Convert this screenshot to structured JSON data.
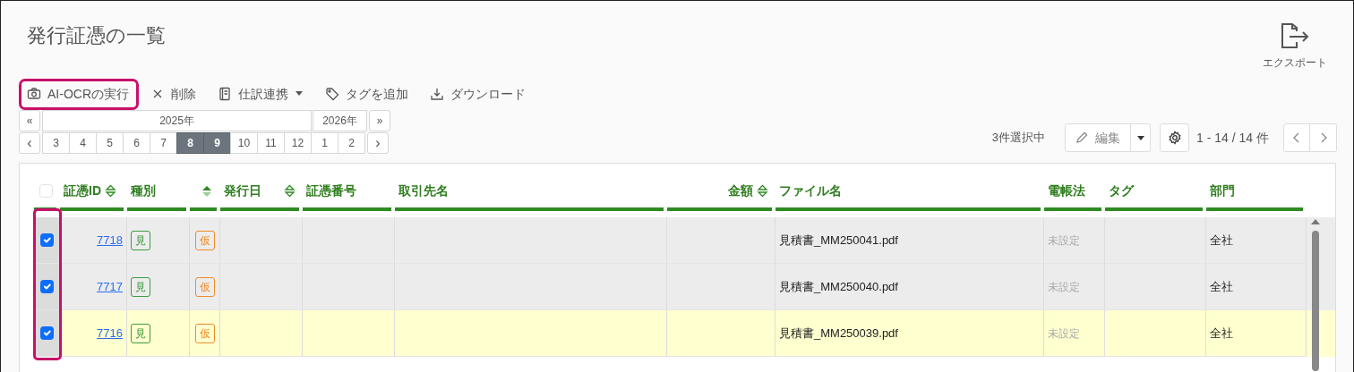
{
  "page": {
    "title": "発行証憑の一覧"
  },
  "export": {
    "label": "エクスポート"
  },
  "toolbar": [
    {
      "kind": "camera",
      "label": "AI-OCRの実行",
      "emphasized": true,
      "dropdown": false
    },
    {
      "kind": "close",
      "label": "削除",
      "emphasized": false,
      "dropdown": false
    },
    {
      "kind": "book",
      "label": "仕訳連携",
      "emphasized": false,
      "dropdown": true
    },
    {
      "kind": "tag",
      "label": "タグを追加",
      "emphasized": false,
      "dropdown": false
    },
    {
      "kind": "download",
      "label": "ダウンロード",
      "emphasized": false,
      "dropdown": false
    }
  ],
  "month_picker": {
    "prev_year": "«",
    "next_year": "»",
    "prev": "‹",
    "next": "›",
    "years": [
      {
        "label": "2025年",
        "months": [
          {
            "label": "3",
            "selected": false
          },
          {
            "label": "4",
            "selected": false
          },
          {
            "label": "5",
            "selected": false
          },
          {
            "label": "6",
            "selected": false
          },
          {
            "label": "7",
            "selected": false
          },
          {
            "label": "8",
            "selected": true
          },
          {
            "label": "9",
            "selected": true
          },
          {
            "label": "10",
            "selected": false
          },
          {
            "label": "11",
            "selected": false
          },
          {
            "label": "12",
            "selected": false
          }
        ]
      },
      {
        "label": "2026年",
        "months": [
          {
            "label": "1",
            "selected": false
          },
          {
            "label": "2",
            "selected": false
          }
        ]
      }
    ]
  },
  "selection_count": "3件選択中",
  "edit_button": {
    "label": "編集"
  },
  "range": "1 - 14 / 14 件",
  "table": {
    "all_checked": false,
    "checkbox_column_emphasized": true,
    "columns": [
      {
        "label": "証憑ID",
        "sortable": true,
        "sort_ascending": false
      },
      {
        "label": "種別"
      },
      {
        "sortable": true,
        "sort_ascending": true
      },
      {
        "label": "発行日",
        "sortable": true,
        "sort_ascending": false
      },
      {
        "label": "証憑番号"
      },
      {
        "label": "取引先名"
      },
      {
        "label": "金額",
        "sortable": true,
        "sort_ascending": false
      },
      {
        "label": "ファイル名"
      },
      {
        "label": "電帳法"
      },
      {
        "label": "タグ"
      },
      {
        "label": "部門"
      }
    ],
    "rows": [
      {
        "selected": true,
        "highlighted": false,
        "id": "7718",
        "type_badge": {
          "text": "見",
          "color": "#3f9b3f"
        },
        "status_badge": {
          "text": "仮",
          "color": "#f08c2a"
        },
        "file": "見積書_MM250041.pdf",
        "denchoho": {
          "text": "未設定",
          "set": false
        },
        "department": "全社"
      },
      {
        "selected": true,
        "highlighted": false,
        "id": "7717",
        "type_badge": {
          "text": "見",
          "color": "#3f9b3f"
        },
        "status_badge": {
          "text": "仮",
          "color": "#f08c2a"
        },
        "file": "見積書_MM250040.pdf",
        "denchoho": {
          "text": "未設定",
          "set": false
        },
        "department": "全社"
      },
      {
        "selected": true,
        "highlighted": true,
        "id": "7716",
        "type_badge": {
          "text": "見",
          "color": "#3f9b3f"
        },
        "status_badge": {
          "text": "仮",
          "color": "#f08c2a"
        },
        "file": "見積書_MM250039.pdf",
        "denchoho": {
          "text": "未設定",
          "set": false
        },
        "department": "全社"
      }
    ]
  }
}
